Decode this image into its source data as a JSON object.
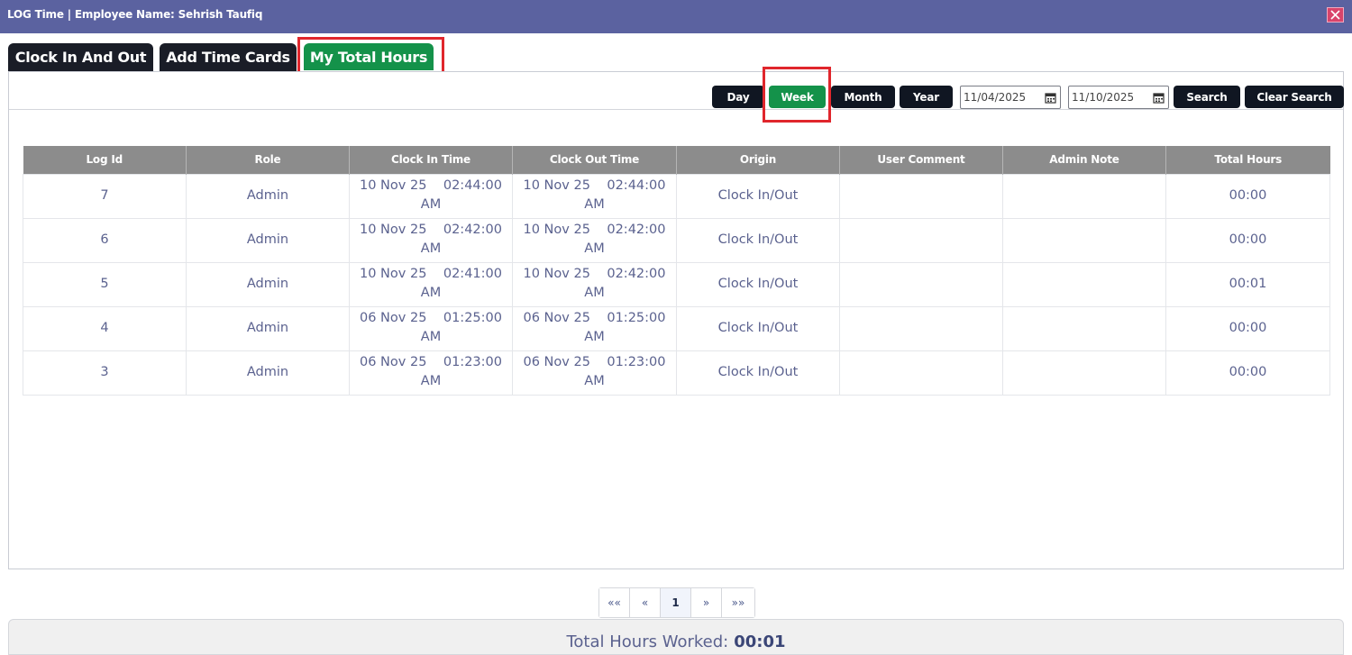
{
  "window": {
    "title": "LOG Time | Employee Name: Sehrish Taufiq"
  },
  "tabs": [
    {
      "label": "Clock In And Out",
      "active": false
    },
    {
      "label": "Add Time Cards",
      "active": false
    },
    {
      "label": "My Total Hours",
      "active": true
    }
  ],
  "filters": {
    "day": "Day",
    "week": "Week",
    "month": "Month",
    "year": "Year",
    "selected": "Week",
    "start_date": "11/04/2025",
    "end_date": "11/10/2025",
    "search": "Search",
    "clear": "Clear Search"
  },
  "table": {
    "columns": [
      "Log Id",
      "Role",
      "Clock In Time",
      "Clock Out Time",
      "Origin",
      "User Comment",
      "Admin Note",
      "Total Hours"
    ],
    "rows": [
      {
        "id": "7",
        "role": "Admin",
        "in_date": "10 Nov 25",
        "in_time": "02:44:00",
        "in_ampm": "AM",
        "out_date": "10 Nov 25",
        "out_time": "02:44:00",
        "out_ampm": "AM",
        "origin": "Clock In/Out",
        "comment": "",
        "note": "",
        "total": "00:00"
      },
      {
        "id": "6",
        "role": "Admin",
        "in_date": "10 Nov 25",
        "in_time": "02:42:00",
        "in_ampm": "AM",
        "out_date": "10 Nov 25",
        "out_time": "02:42:00",
        "out_ampm": "AM",
        "origin": "Clock In/Out",
        "comment": "",
        "note": "",
        "total": "00:00"
      },
      {
        "id": "5",
        "role": "Admin",
        "in_date": "10 Nov 25",
        "in_time": "02:41:00",
        "in_ampm": "AM",
        "out_date": "10 Nov 25",
        "out_time": "02:42:00",
        "out_ampm": "AM",
        "origin": "Clock In/Out",
        "comment": "",
        "note": "",
        "total": "00:01"
      },
      {
        "id": "4",
        "role": "Admin",
        "in_date": "06 Nov 25",
        "in_time": "01:25:00",
        "in_ampm": "AM",
        "out_date": "06 Nov 25",
        "out_time": "01:25:00",
        "out_ampm": "AM",
        "origin": "Clock In/Out",
        "comment": "",
        "note": "",
        "total": "00:00"
      },
      {
        "id": "3",
        "role": "Admin",
        "in_date": "06 Nov 25",
        "in_time": "01:23:00",
        "in_ampm": "AM",
        "out_date": "06 Nov 25",
        "out_time": "01:23:00",
        "out_ampm": "AM",
        "origin": "Clock In/Out",
        "comment": "",
        "note": "",
        "total": "00:00"
      }
    ]
  },
  "pagination": {
    "first": "««",
    "prev": "«",
    "current": "1",
    "next": "»",
    "last": "»»"
  },
  "footer": {
    "label": "Total Hours Worked:",
    "value": "00:01"
  },
  "icons": {
    "close": "close-icon",
    "calendar": "calendar-icon"
  },
  "colors": {
    "titlebar": "#5b62a0",
    "tab_dark": "#1a1d27",
    "accent_green": "#14924a",
    "highlight_red": "#e0262c",
    "header_gray": "#8c8c8c",
    "text_blue": "#5b628f"
  }
}
